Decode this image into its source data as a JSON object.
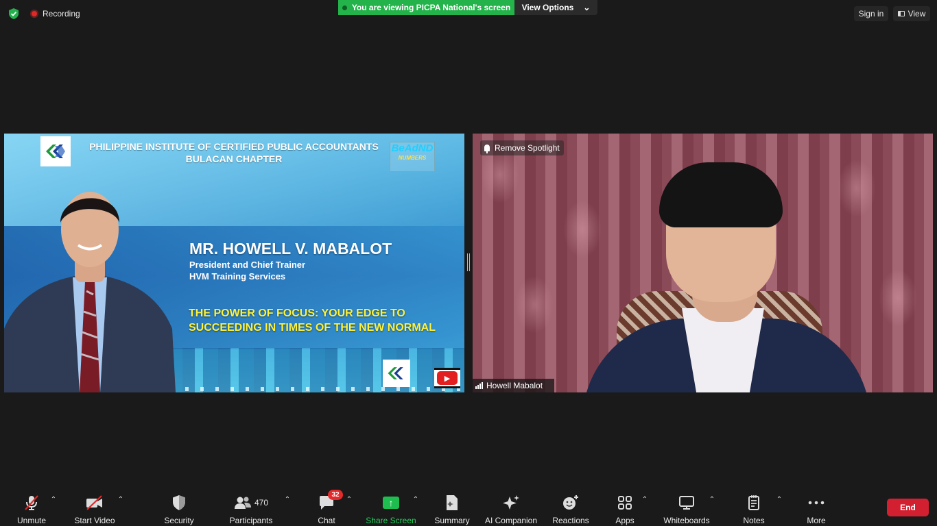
{
  "topbar": {
    "recording_label": "Recording",
    "viewing_banner": "You are viewing PICPA National's screen",
    "view_options_label": "View Options",
    "sign_in_label": "Sign in",
    "view_label": "View"
  },
  "share": {
    "org_line1": "PHILIPPINE INSTITUTE OF CERTIFIED PUBLIC ACCOUNTANTS",
    "org_line2": "BULACAN CHAPTER",
    "badge_text": "BeAdND",
    "badge_sub": "NUMBERS",
    "speaker_name": "MR. HOWELL V. MABALOT",
    "speaker_title": "President and Chief Trainer",
    "speaker_company": "HVM Training Services",
    "topic_line1": "THE POWER OF FOCUS: YOUR EDGE TO",
    "topic_line2": "SUCCEEDING IN TIMES OF THE NEW NORMAL"
  },
  "video": {
    "remove_spotlight_label": "Remove Spotlight",
    "participant_name": "Howell Mabalot"
  },
  "toolbar": {
    "unmute": "Unmute",
    "start_video": "Start Video",
    "security": "Security",
    "participants": "Participants",
    "participants_count": "470",
    "chat": "Chat",
    "chat_badge": "32",
    "share_screen": "Share Screen",
    "summary": "Summary",
    "ai_companion": "AI Companion",
    "reactions": "Reactions",
    "apps": "Apps",
    "whiteboards": "Whiteboards",
    "notes": "Notes",
    "more": "More",
    "end": "End"
  },
  "colors": {
    "viewing_green": "#23b34a",
    "share_green": "#1fd05b",
    "end_red": "#d32030",
    "topic_yellow": "#fff23a"
  }
}
